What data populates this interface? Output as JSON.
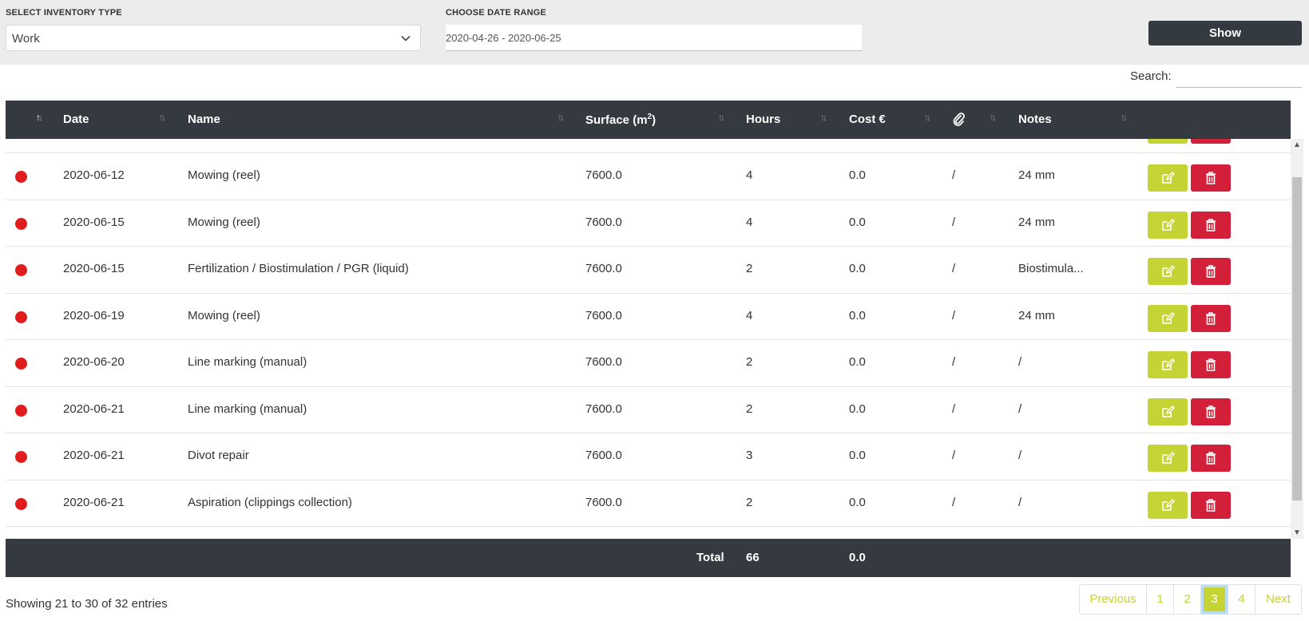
{
  "filters": {
    "inventory_type_label": "SELECT INVENTORY TYPE",
    "inventory_type_value": "Work",
    "date_range_label": "CHOOSE DATE RANGE",
    "date_range_value": "2020-04-26 - 2020-06-25",
    "show_label": "Show"
  },
  "search": {
    "label": "Search:",
    "value": ""
  },
  "table": {
    "headers": {
      "date": "Date",
      "name": "Name",
      "surface": "Surface (m",
      "surface_sup": "2",
      "surface_close": ")",
      "hours": "Hours",
      "cost": "Cost €",
      "attachment_icon": "paperclip-icon",
      "notes": "Notes",
      "sort_icon": "↑↓"
    },
    "rows": [
      {
        "date": "2020-06-12",
        "name": "Mowing (reel)",
        "surface": "7600.0",
        "hours": "4",
        "cost": "0.0",
        "attachment": "/",
        "notes": "24 mm"
      },
      {
        "date": "2020-06-15",
        "name": "Mowing (reel)",
        "surface": "7600.0",
        "hours": "4",
        "cost": "0.0",
        "attachment": "/",
        "notes": "24 mm"
      },
      {
        "date": "2020-06-15",
        "name": "Fertilization / Biostimulation / PGR (liquid)",
        "surface": "7600.0",
        "hours": "2",
        "cost": "0.0",
        "attachment": "/",
        "notes": "Biostimula..."
      },
      {
        "date": "2020-06-19",
        "name": "Mowing (reel)",
        "surface": "7600.0",
        "hours": "4",
        "cost": "0.0",
        "attachment": "/",
        "notes": "24 mm"
      },
      {
        "date": "2020-06-20",
        "name": "Line marking (manual)",
        "surface": "7600.0",
        "hours": "2",
        "cost": "0.0",
        "attachment": "/",
        "notes": "/"
      },
      {
        "date": "2020-06-21",
        "name": "Line marking (manual)",
        "surface": "7600.0",
        "hours": "2",
        "cost": "0.0",
        "attachment": "/",
        "notes": "/"
      },
      {
        "date": "2020-06-21",
        "name": "Divot repair",
        "surface": "7600.0",
        "hours": "3",
        "cost": "0.0",
        "attachment": "/",
        "notes": "/"
      },
      {
        "date": "2020-06-21",
        "name": "Aspiration (clippings collection)",
        "surface": "7600.0",
        "hours": "2",
        "cost": "0.0",
        "attachment": "/",
        "notes": "/"
      }
    ],
    "footer": {
      "total_label": "Total",
      "hours_total": "66",
      "cost_total": "0.0"
    }
  },
  "info": "Showing 21 to 30 of 32 entries",
  "pagination": {
    "previous": "Previous",
    "pages": [
      "1",
      "2",
      "3",
      "4"
    ],
    "active": "3",
    "next": "Next"
  },
  "colors": {
    "header_bg": "#343a40",
    "edit_button": "#c6d335",
    "delete_button": "#d3203a",
    "status_dot": "#e01c1c"
  }
}
